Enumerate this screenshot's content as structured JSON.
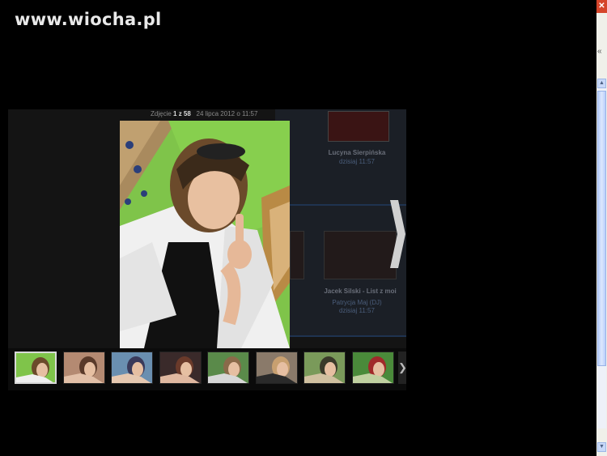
{
  "watermark": {
    "text": "www.wiocha.pl"
  },
  "lightbox": {
    "caption_prefix": "Zdjęcie",
    "caption_index": "1 z 58",
    "caption_date": "24 lipca 2012 o 11:57",
    "next_arrow": "❯",
    "strip_next": "❯",
    "thumbnail_count": 8,
    "active_thumbnail": 1
  },
  "background_page": {
    "friend_name": "Lucyna Sierpińska",
    "friend_time": "dzisiaj 11:57",
    "video_title": "Jacek Silski - List z moi",
    "video_author": "Patrycja Maj (DJ)",
    "video_time": "dzisiaj 11:57"
  },
  "window": {
    "close_glyph": "✕",
    "side_glyph": "«",
    "scroll_up": "▲",
    "scroll_down": "▼"
  }
}
